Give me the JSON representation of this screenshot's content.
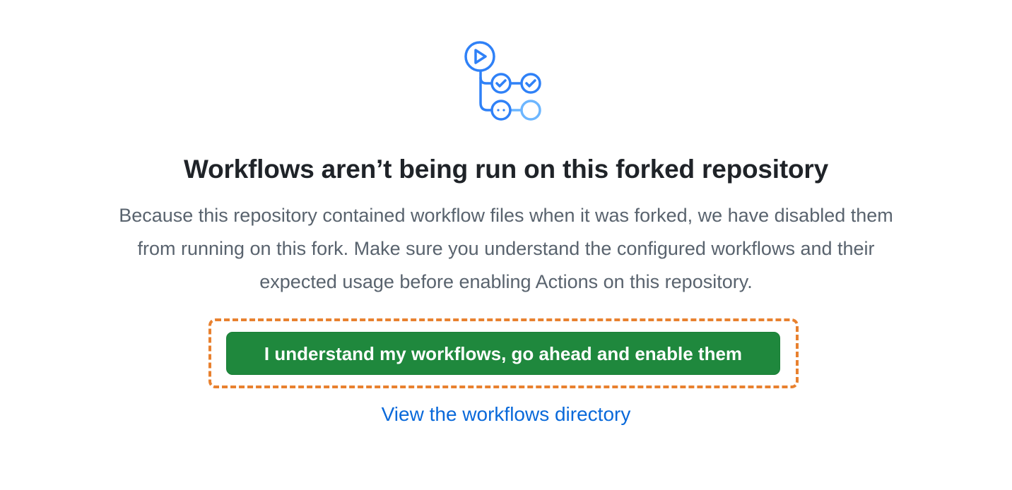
{
  "hero": {
    "icon": "actions-workflow-icon",
    "accent_color": "#2f81f7",
    "accent_light_color": "#6cb6ff"
  },
  "title": "Workflows aren’t being run on this forked repository",
  "description": {
    "line1": "Because this repository contained workflow files when it was forked, we have disabled them",
    "line2": "from running on this fork. Make sure you understand the configured workflows and their",
    "line3": "expected usage before enabling Actions on this repository."
  },
  "enable_button": {
    "label": "I understand my workflows, go ahead and enable them",
    "color": "#1f883d"
  },
  "highlight": {
    "color": "#e8812f"
  },
  "workflows_link": {
    "label": "View the workflows directory",
    "color": "#0969da"
  }
}
